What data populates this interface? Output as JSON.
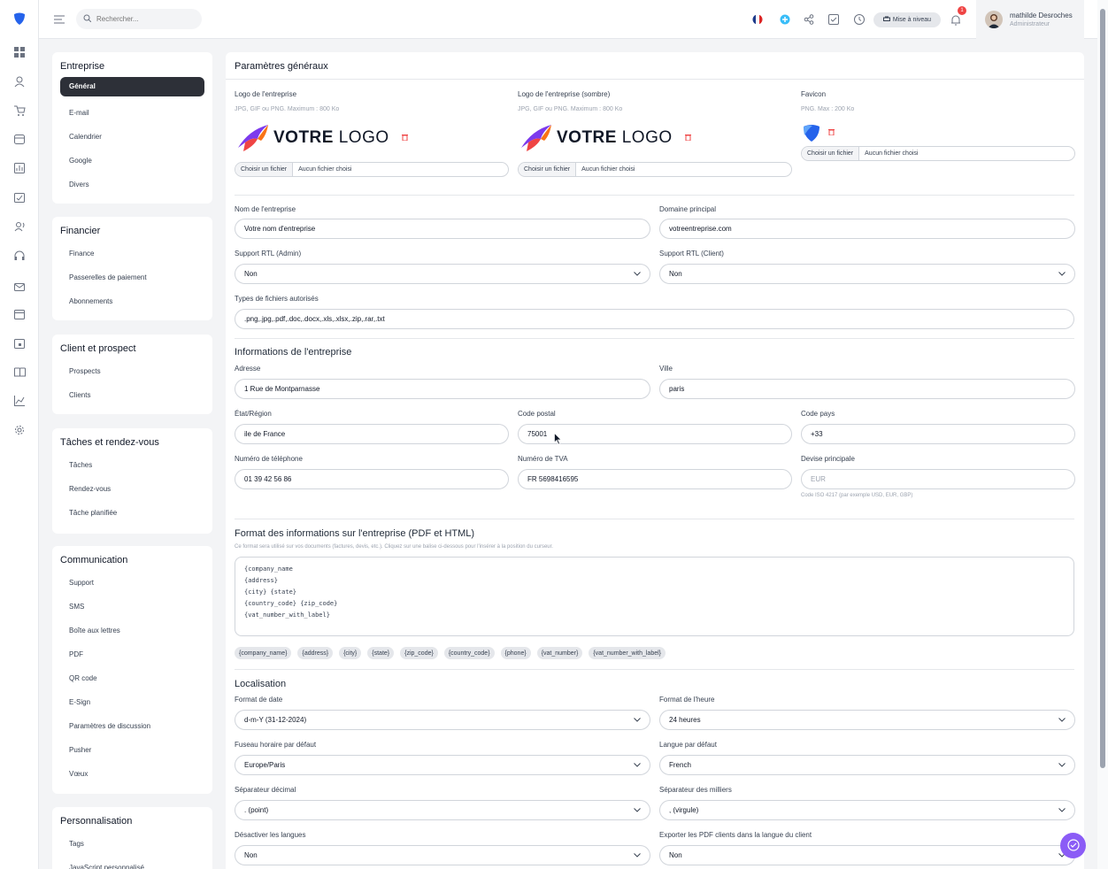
{
  "topbar": {
    "search_placeholder": "Rechercher...",
    "upgrade_label": "Mise à niveau",
    "notifications_count": "1",
    "user_name": "mathilde Desroches",
    "user_role": "Administrateur"
  },
  "sidebar": {
    "entreprise": {
      "title": "Entreprise",
      "items": [
        "Général",
        "E-mail",
        "Calendrier",
        "Google",
        "Divers"
      ]
    },
    "financier": {
      "title": "Financier",
      "items": [
        "Finance",
        "Passerelles de paiement",
        "Abonnements"
      ]
    },
    "client": {
      "title": "Client et prospect",
      "items": [
        "Prospects",
        "Clients"
      ]
    },
    "taches": {
      "title": "Tâches et rendez-vous",
      "items": [
        "Tâches",
        "Rendez-vous",
        "Tâche planifiée"
      ]
    },
    "communication": {
      "title": "Communication",
      "items": [
        "Support",
        "SMS",
        "Boîte aux lettres",
        "PDF",
        "QR code",
        "E-Sign",
        "Paramètres de discussion",
        "Pusher",
        "Vœux"
      ]
    },
    "perso": {
      "title": "Personnalisation",
      "items": [
        "Tags",
        "JavaScript personnalisé"
      ]
    }
  },
  "main": {
    "title": "Paramètres généraux",
    "logo": {
      "label": "Logo de l'entreprise",
      "hint": "JPG, GIF ou PNG. Maximum : 800 Ko"
    },
    "logo_dark": {
      "label": "Logo de l'entreprise (sombre)",
      "hint": "JPG, GIF ou PNG. Maximum : 800 Ko"
    },
    "favicon": {
      "label": "Favicon",
      "hint": "PNG. Max : 200 Ko"
    },
    "logo_text_bold": "VOTRE",
    "logo_text_light": " LOGO",
    "file_button": "Choisir un fichier",
    "file_none": "Aucun fichier choisi",
    "company_name": {
      "label": "Nom de l'entreprise",
      "value": "Votre nom d'entreprise"
    },
    "main_domain": {
      "label": "Domaine principal",
      "value": "votreentreprise.com"
    },
    "rtl_admin": {
      "label": "Support RTL (Admin)",
      "value": "Non"
    },
    "rtl_client": {
      "label": "Support RTL (Client)",
      "value": "Non"
    },
    "file_types": {
      "label": "Types de fichiers autorisés",
      "value": ".png,.jpg,.pdf,.doc,.docx,.xls,.xlsx,.zip,.rar,.txt"
    },
    "info_title": "Informations de l'entreprise",
    "address": {
      "label": "Adresse",
      "value": "1 Rue de Montparnasse"
    },
    "city": {
      "label": "Ville",
      "value": "paris"
    },
    "state": {
      "label": "État/Région",
      "value": "ile de France"
    },
    "zip": {
      "label": "Code postal",
      "value": "75001"
    },
    "country_code": {
      "label": "Code pays",
      "value": "+33"
    },
    "phone": {
      "label": "Numéro de téléphone",
      "value": "01 39 42 56 86"
    },
    "vat": {
      "label": "Numéro de TVA",
      "value": "FR 5698416595"
    },
    "currency": {
      "label": "Devise principale",
      "placeholder": "EUR",
      "hint": "Code ISO 4217 (par exemple USD, EUR, GBP)"
    },
    "format_title": "Format des informations sur l'entreprise (PDF et HTML)",
    "format_hint": "Ce format sera utilisé sur vos documents (factures, devis, etc.). Cliquez sur une balise ci-dessous pour l'insérer à la position du curseur.",
    "format_lines": [
      "{company_name",
      "{address}",
      "{city} {state}",
      "{country_code} {zip_code}",
      "{vat_number_with_label}"
    ],
    "chips": [
      "{company_name}",
      "{address}",
      "{city}",
      "{state}",
      "{zip_code}",
      "{country_code}",
      "{phone}",
      "{vat_number}",
      "{vat_number_with_label}"
    ],
    "loc_title": "Localisation",
    "date_format": {
      "label": "Format de date",
      "value": "d-m-Y (31-12-2024)"
    },
    "time_format": {
      "label": "Format de l'heure",
      "value": "24 heures"
    },
    "timezone": {
      "label": "Fuseau horaire par défaut",
      "value": "Europe/Paris"
    },
    "language": {
      "label": "Langue par défaut",
      "value": "French"
    },
    "decimal_sep": {
      "label": "Séparateur décimal",
      "value": ". (point)"
    },
    "thousand_sep": {
      "label": "Séparateur des milliers",
      "value": ", (virgule)"
    },
    "disable_lang": {
      "label": "Désactiver les langues",
      "value": "Non"
    },
    "export_pdf": {
      "label": "Exporter les PDF clients dans la langue du client",
      "value": "Non"
    }
  },
  "colors": {
    "accent": "#2d3038",
    "brand": "#2563eb",
    "fab": "#8b5cf6",
    "danger": "#ef4444"
  }
}
